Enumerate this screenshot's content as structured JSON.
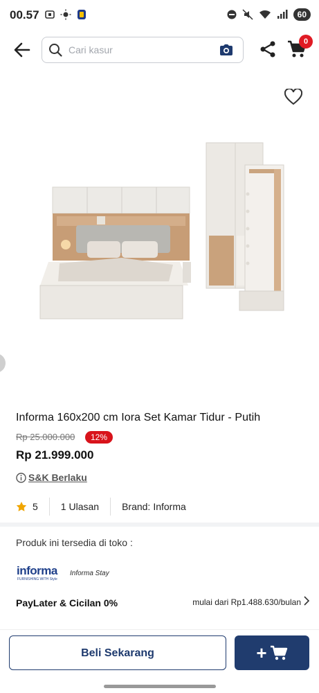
{
  "status_bar": {
    "time": "00.57",
    "battery": "60"
  },
  "search": {
    "placeholder": "Cari kasur"
  },
  "cart": {
    "count": "0"
  },
  "product": {
    "title": "Informa 160x200 cm Iora Set Kamar Tidur - Putih",
    "original_price": "Rp 25.000.000",
    "discount": "12%",
    "price": "Rp 21.999.000",
    "terms_label": "S&K Berlaku",
    "rating": "5",
    "reviews": "1 Ulasan",
    "brand_label": "Brand:",
    "brand": "Informa"
  },
  "store": {
    "available_text": "Produk ini tersedia di toko :",
    "logo1": "informa",
    "logo1_sub": "FURNISHING WITH Style",
    "logo2": "Informa Stay"
  },
  "paylater": {
    "label": "PayLater & Cicilan 0%",
    "detail": "mulai dari Rp1.488.630/bulan"
  },
  "actions": {
    "buy_label": "Beli Sekarang",
    "add_label": "+"
  },
  "colors": {
    "primary": "#203c6e",
    "discount": "#d8131b",
    "badge": "#e01b24"
  }
}
